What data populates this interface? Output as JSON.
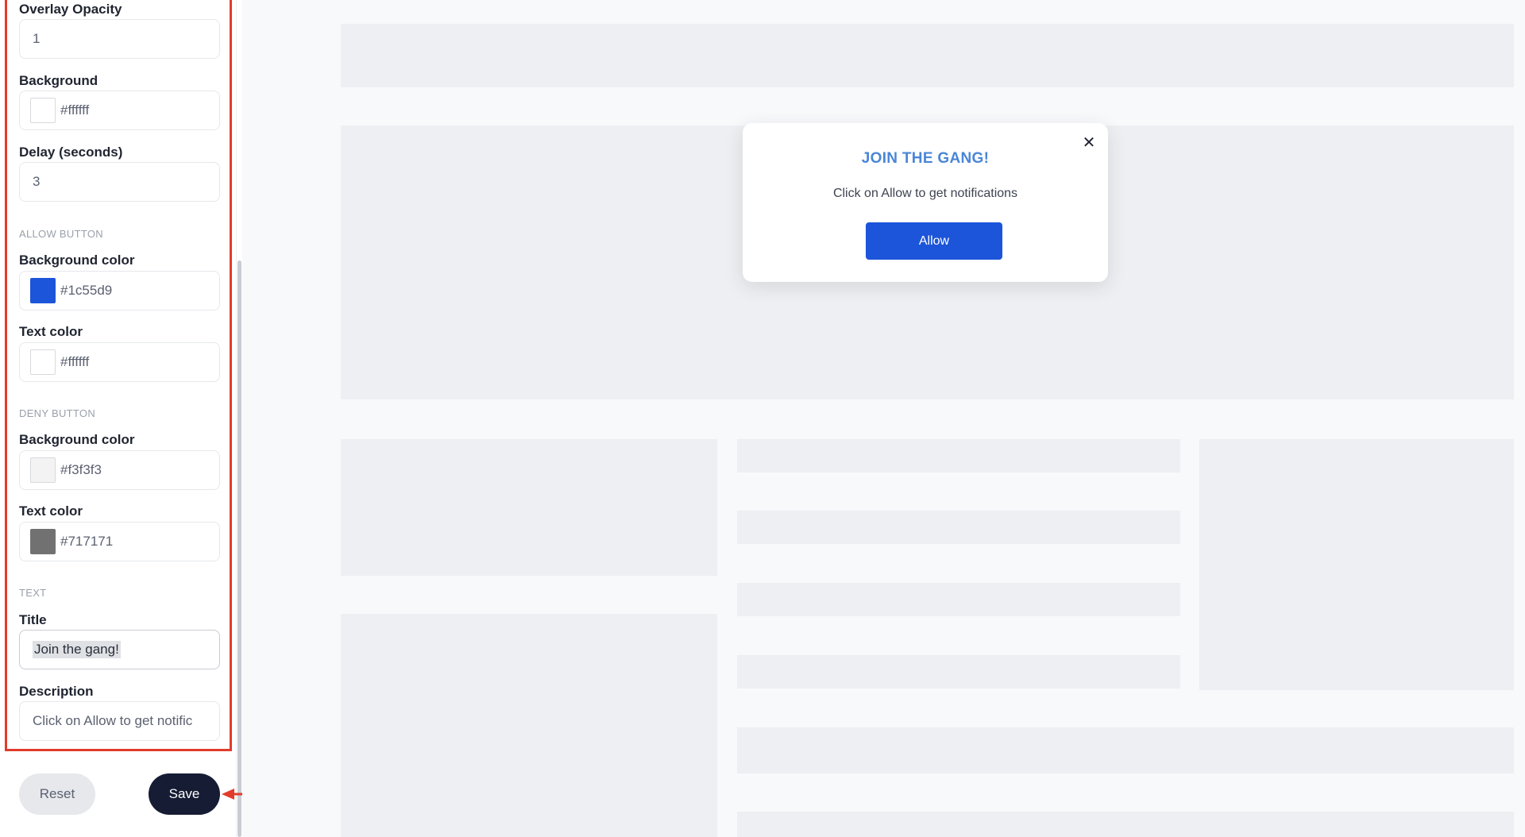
{
  "sidebar": {
    "overlay_opacity": {
      "label": "Overlay Opacity",
      "value": "1"
    },
    "background": {
      "label": "Background",
      "value": "#ffffff",
      "swatch": "#ffffff"
    },
    "delay": {
      "label": "Delay (seconds)",
      "value": "3"
    },
    "allow_button": {
      "section": "ALLOW BUTTON",
      "bg_label": "Background color",
      "bg_value": "#1c55d9",
      "bg_swatch": "#1c55d9",
      "text_label": "Text color",
      "text_value": "#ffffff",
      "text_swatch": "#ffffff"
    },
    "deny_button": {
      "section": "DENY BUTTON",
      "bg_label": "Background color",
      "bg_value": "#f3f3f3",
      "bg_swatch": "#f3f3f3",
      "text_label": "Text color",
      "text_value": "#717171",
      "text_swatch": "#717171"
    },
    "text": {
      "section": "TEXT",
      "title_label": "Title",
      "title_value": "Join the gang!",
      "desc_label": "Description",
      "desc_value": "Click on Allow to get notific"
    },
    "reset_label": "Reset",
    "save_label": "Save"
  },
  "modal": {
    "title": "JOIN THE GANG!",
    "description": "Click on Allow to get notifications",
    "allow_label": "Allow",
    "close_glyph": "✕"
  },
  "colors": {
    "highlight": "#e23b2b",
    "allow_bg": "#1c55d9",
    "save_bg": "#151c33",
    "title_color": "#4a86d6"
  }
}
